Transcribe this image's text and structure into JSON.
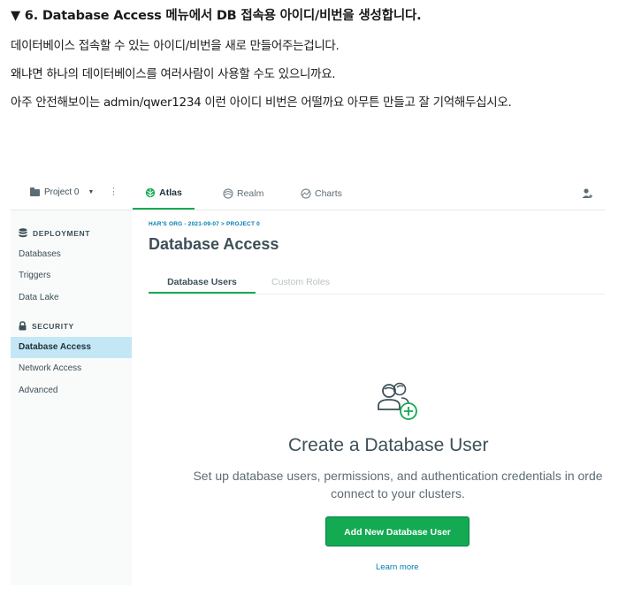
{
  "post": {
    "heading": "▼ 6. Database Access 메뉴에서 DB 접속용 아이디/비번을 생성합니다.",
    "paragraphs": [
      "데이터베이스 접속할 수 있는 아이디/비번을 새로 만들어주는겁니다.",
      "왜냐면 하나의 데이터베이스를 여러사람이 사용할 수도 있으니까요.",
      "아주 안전해보이는 admin/qwer1234 이런 아이디 비번은 어떨까요 아무튼 만들고 잘 기억해두십시오."
    ]
  },
  "topbar": {
    "project_label": "Project 0",
    "tabs": [
      {
        "label": "Atlas",
        "icon": "leaf-icon",
        "active": true
      },
      {
        "label": "Realm",
        "icon": "realm-icon",
        "active": false
      },
      {
        "label": "Charts",
        "icon": "charts-icon",
        "active": false
      }
    ]
  },
  "sidebar": {
    "deployment_title": "DEPLOYMENT",
    "deployment_items": [
      "Databases",
      "Triggers",
      "Data Lake"
    ],
    "security_title": "SECURITY",
    "security_items": [
      "Database Access",
      "Network Access",
      "Advanced"
    ],
    "active_item": "Database Access"
  },
  "main": {
    "breadcrumb": "HAR'S ORG - 2021-09-07 > PROJECT 0",
    "title": "Database Access",
    "tabs": [
      "Database Users",
      "Custom Roles"
    ],
    "empty_title": "Create a Database User",
    "empty_desc_line1": "Set up database users, permissions, and authentication credentials in orde",
    "empty_desc_line2": "connect to your clusters.",
    "add_button": "Add New Database User",
    "learn_more": "Learn more"
  },
  "colors": {
    "accent_green": "#13aa52",
    "link_blue": "#007cad",
    "active_item_bg": "#c3e7f5"
  }
}
